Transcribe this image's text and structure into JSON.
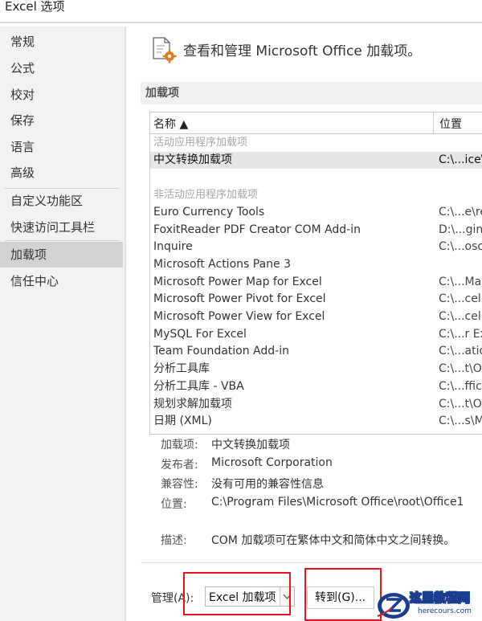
{
  "window": {
    "title": "Excel 选项"
  },
  "sidebar": {
    "items": [
      {
        "label": "常规"
      },
      {
        "label": "公式"
      },
      {
        "label": "校对"
      },
      {
        "label": "保存"
      },
      {
        "label": "语言"
      },
      {
        "label": "高级"
      },
      {
        "label": "自定义功能区"
      },
      {
        "label": "快速访问工具栏"
      },
      {
        "label": "加载项"
      },
      {
        "label": "信任中心"
      }
    ],
    "selected": "加载项"
  },
  "main": {
    "header_text": "查看和管理 Microsoft Office 加载项。",
    "section_title": "加载项"
  },
  "table": {
    "columns": [
      "名称 ▲",
      "位置"
    ],
    "rows": [
      {
        "type": "group",
        "name": "活动应用程序加载项",
        "loc": ""
      },
      {
        "type": "item",
        "name": "中文转换加载项",
        "loc": "C:\\...ice\\",
        "selected": true
      },
      {
        "type": "blank",
        "name": "",
        "loc": ""
      },
      {
        "type": "group",
        "name": "非活动应用程序加载项",
        "loc": ""
      },
      {
        "type": "item",
        "name": "Euro Currency Tools",
        "loc": "C:\\...e\\re"
      },
      {
        "type": "item",
        "name": "FoxitReader PDF Creator COM Add-in",
        "loc": "D:\\...gin"
      },
      {
        "type": "item",
        "name": "Inquire",
        "loc": "C:\\...osc"
      },
      {
        "type": "item",
        "name": "Microsoft Actions Pane 3",
        "loc": ""
      },
      {
        "type": "item",
        "name": "Microsoft Power Map for Excel",
        "loc": "C:\\...Ma"
      },
      {
        "type": "item",
        "name": "Microsoft Power Pivot for Excel",
        "loc": "C:\\...cel"
      },
      {
        "type": "item",
        "name": "Microsoft Power View for Excel",
        "loc": "C:\\...cel"
      },
      {
        "type": "item",
        "name": "MySQL For Excel",
        "loc": "C:\\...r Ex"
      },
      {
        "type": "item",
        "name": "Team Foundation Add-in",
        "loc": "C:\\...atio"
      },
      {
        "type": "item",
        "name": "分析工具库",
        "loc": "C:\\...t\\O"
      },
      {
        "type": "item",
        "name": "分析工具库 - VBA",
        "loc": "C:\\...ffic"
      },
      {
        "type": "item",
        "name": "规划求解加载项",
        "loc": "C:\\...t\\O"
      },
      {
        "type": "item",
        "name": "日期 (XML)",
        "loc": "C:\\...s\\M"
      }
    ]
  },
  "details": {
    "addin_label": "加载项:",
    "addin_value": "中文转换加载项",
    "publisher_label": "发布者:",
    "publisher_value": "Microsoft Corporation",
    "compat_label": "兼容性:",
    "compat_value": "没有可用的兼容性信息",
    "location_label": "位置:",
    "location_value": "C:\\Program Files\\Microsoft Office\\root\\Office1",
    "desc_label": "描述:",
    "desc_value": "COM 加载项可在繁体中文和简体中文之间转换。"
  },
  "bottom": {
    "manage_label": "管理(A):",
    "manage_value": "Excel 加载项",
    "goto_label": "转到(G)..."
  },
  "watermark": {
    "title": "这里教程网",
    "url": "herecours.com"
  },
  "colors": {
    "highlight_red": "#e8141d",
    "selected_row": "#e6e6e6",
    "sidebar_bg": "#f2f2f2",
    "watermark_blue": "#1a3d8f"
  }
}
